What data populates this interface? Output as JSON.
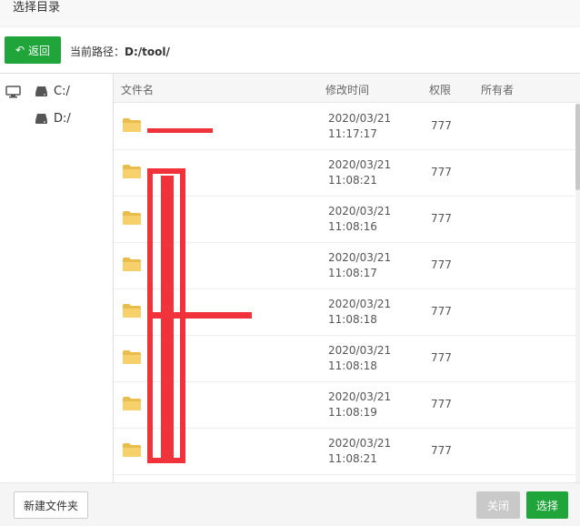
{
  "dialog": {
    "title": "选择目录"
  },
  "toolbar": {
    "back_label": "返回",
    "path_label": "当前路径：",
    "path_value": "D:/tool/"
  },
  "sidebar": {
    "drives": [
      {
        "label": "C:/"
      },
      {
        "label": "D:/"
      }
    ]
  },
  "table": {
    "headers": {
      "name": "文件名",
      "mtime": "修改时间",
      "perm": "权限",
      "owner": "所有者"
    },
    "rows": [
      {
        "name": "",
        "date": "2020/03/21",
        "time": "11:17:17",
        "perm": "777",
        "owner": ""
      },
      {
        "name": "",
        "date": "2020/03/21",
        "time": "11:08:21",
        "perm": "777",
        "owner": ""
      },
      {
        "name": "",
        "date": "2020/03/21",
        "time": "11:08:16",
        "perm": "777",
        "owner": ""
      },
      {
        "name": "",
        "date": "2020/03/21",
        "time": "11:08:17",
        "perm": "777",
        "owner": ""
      },
      {
        "name": "",
        "date": "2020/03/21",
        "time": "11:08:18",
        "perm": "777",
        "owner": ""
      },
      {
        "name": "",
        "date": "2020/03/21",
        "time": "11:08:18",
        "perm": "777",
        "owner": ""
      },
      {
        "name": "",
        "date": "2020/03/21",
        "time": "11:08:19",
        "perm": "777",
        "owner": ""
      },
      {
        "name": "",
        "date": "2020/03/21",
        "time": "11:08:21",
        "perm": "777",
        "owner": ""
      }
    ]
  },
  "footer": {
    "new_folder_label": "新建文件夹",
    "close_label": "关闭",
    "select_label": "选择"
  },
  "colors": {
    "accent": "#20a53a",
    "folder": "#f0c85a",
    "disabled": "#c9c9c9",
    "redaction": "#f0333a"
  }
}
